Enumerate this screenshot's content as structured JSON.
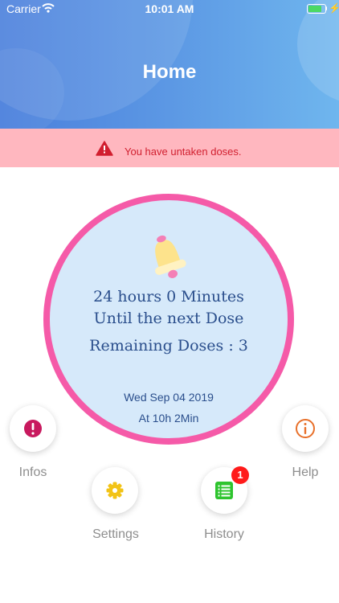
{
  "status_bar": {
    "carrier": "Carrier",
    "time": "10:01 AM"
  },
  "header": {
    "title": "Home"
  },
  "alert": {
    "message": "You have untaken doses."
  },
  "dose_card": {
    "line1": "24 hours 0 Minutes",
    "line2": "Until the next Dose",
    "remaining": "Remaining Doses : 3",
    "date": "Wed Sep 04 2019",
    "at": "At 10h 2Min"
  },
  "actions": {
    "infos": "Infos",
    "help": "Help",
    "settings": "Settings",
    "history": "History",
    "history_badge": "1"
  },
  "colors": {
    "header_start": "#4a7fdc",
    "header_end": "#6fb6ee",
    "alert_bg": "#ffb7bf",
    "alert_text": "#d11f2f",
    "ring": "#f55aa8",
    "card_bg": "#d6e9fa",
    "card_text": "#2a4e8c",
    "infos_icon": "#c8195e",
    "help_icon": "#e8702a",
    "settings_icon": "#f2c316",
    "history_icon": "#2ec42e"
  },
  "icons": {
    "alert": "warning-triangle-icon",
    "bell": "bell-icon",
    "infos": "exclamation-circle-icon",
    "help": "info-circle-icon",
    "settings": "gear-icon",
    "history": "list-icon"
  }
}
